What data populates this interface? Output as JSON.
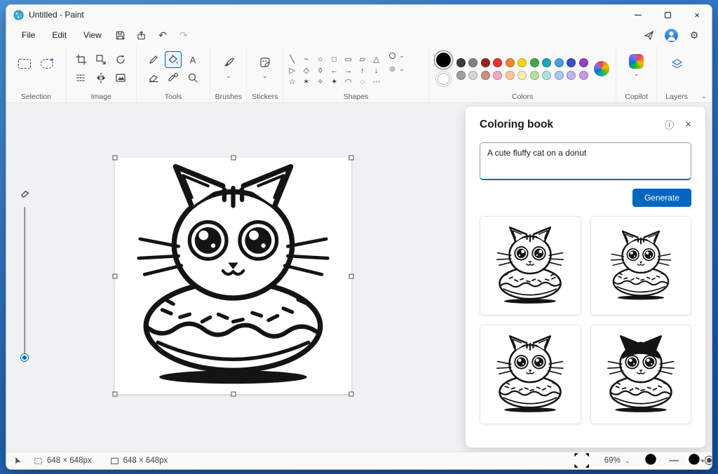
{
  "window": {
    "title": "Untitled - Paint"
  },
  "menubar": {
    "menus": [
      "File",
      "Edit",
      "View"
    ]
  },
  "icons": {
    "undo": "↶",
    "redo": "↷",
    "chevron_down": "⌄",
    "info": "ⓘ",
    "close": "×",
    "gear": "⚙",
    "text_tool": "A"
  },
  "ribbon": {
    "groups": [
      "Selection",
      "Image",
      "Tools",
      "Brushes",
      "Stickers",
      "Shapes",
      "Colors",
      "Copilot",
      "Layers"
    ],
    "shapes": [
      "╲",
      "~",
      "○",
      "□",
      "▭",
      "▱",
      "△",
      "▷",
      "◇",
      "◊",
      "←",
      "→",
      "↑",
      "↓",
      "☆",
      "✶",
      "✧",
      "✦",
      "◠",
      "◌",
      "⋯"
    ]
  },
  "colors": {
    "foreground": "#000000",
    "background": "#ffffff",
    "row1": [
      "#3c3c3c",
      "#828282",
      "#99201f",
      "#e8322e",
      "#f58231",
      "#f7d417",
      "#46a64a",
      "#18a5b8",
      "#4e9ae0",
      "#3a4fc2",
      "#9440bd"
    ],
    "row2": [
      "#9e9e9e",
      "#d6d6d6",
      "#c98f82",
      "#f3a6c0",
      "#f8c89a",
      "#f7eeab",
      "#b8e09a",
      "#a6e4e0",
      "#a9c8ef",
      "#beb4ea",
      "#c99ae0"
    ]
  },
  "panel": {
    "title": "Coloring book",
    "prompt": "A cute fluffy cat on a donut",
    "generate": "Generate"
  },
  "statusbar": {
    "selection_size": "648 × 648px",
    "canvas_size": "648 × 648px",
    "zoom": "69%"
  }
}
